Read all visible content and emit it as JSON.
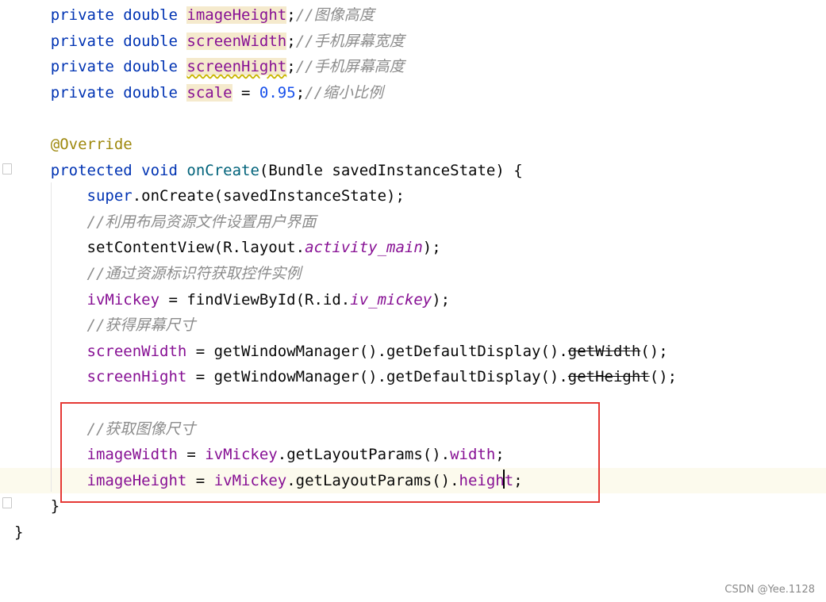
{
  "editor": {
    "lines": [
      {
        "tokens": [
          {
            "t": "    "
          },
          {
            "t": "private",
            "c": "kw"
          },
          {
            "t": " "
          },
          {
            "t": "double",
            "c": "kw"
          },
          {
            "t": " "
          },
          {
            "t": "imageHeight",
            "c": "field hl"
          },
          {
            "t": ";"
          },
          {
            "t": "//图像高度",
            "c": "comment"
          }
        ]
      },
      {
        "tokens": [
          {
            "t": "    "
          },
          {
            "t": "private",
            "c": "kw"
          },
          {
            "t": " "
          },
          {
            "t": "double",
            "c": "kw"
          },
          {
            "t": " "
          },
          {
            "t": "screenWidth",
            "c": "field hl"
          },
          {
            "t": ";"
          },
          {
            "t": "//手机屏幕宽度",
            "c": "comment"
          }
        ]
      },
      {
        "tokens": [
          {
            "t": "    "
          },
          {
            "t": "private",
            "c": "kw"
          },
          {
            "t": " "
          },
          {
            "t": "double",
            "c": "kw"
          },
          {
            "t": " "
          },
          {
            "t": "screenHight",
            "c": "field hl warn"
          },
          {
            "t": ";"
          },
          {
            "t": "//手机屏幕高度",
            "c": "comment"
          }
        ]
      },
      {
        "tokens": [
          {
            "t": "    "
          },
          {
            "t": "private",
            "c": "kw"
          },
          {
            "t": " "
          },
          {
            "t": "double",
            "c": "kw"
          },
          {
            "t": " "
          },
          {
            "t": "scale",
            "c": "field hl"
          },
          {
            "t": " = "
          },
          {
            "t": "0.95",
            "c": "num"
          },
          {
            "t": ";"
          },
          {
            "t": "//缩小比例",
            "c": "comment"
          }
        ]
      },
      {
        "tokens": []
      },
      {
        "tokens": [
          {
            "t": "    "
          },
          {
            "t": "@Override",
            "c": "annot"
          }
        ]
      },
      {
        "tokens": [
          {
            "t": "    "
          },
          {
            "t": "protected",
            "c": "kw"
          },
          {
            "t": " "
          },
          {
            "t": "void",
            "c": "kw"
          },
          {
            "t": " "
          },
          {
            "t": "onCreate",
            "c": "method"
          },
          {
            "t": "(Bundle savedInstanceState) {"
          }
        ]
      },
      {
        "tokens": [
          {
            "t": "        "
          },
          {
            "t": "super",
            "c": "kw"
          },
          {
            "t": ".onCreate(savedInstanceState);"
          }
        ]
      },
      {
        "tokens": [
          {
            "t": "        "
          },
          {
            "t": "//利用布局资源文件设置用户界面",
            "c": "comment"
          }
        ]
      },
      {
        "tokens": [
          {
            "t": "        "
          },
          {
            "t": "setContentView(R.layout."
          },
          {
            "t": "activity_main",
            "c": "field-i"
          },
          {
            "t": ");"
          }
        ]
      },
      {
        "tokens": [
          {
            "t": "        "
          },
          {
            "t": "//通过资源标识符获取控件实例",
            "c": "comment"
          }
        ]
      },
      {
        "tokens": [
          {
            "t": "        "
          },
          {
            "t": "ivMickey",
            "c": "field"
          },
          {
            "t": " = findViewById(R.id."
          },
          {
            "t": "iv_mickey",
            "c": "field-i"
          },
          {
            "t": ");"
          }
        ]
      },
      {
        "tokens": [
          {
            "t": "        "
          },
          {
            "t": "//获得屏幕尺寸",
            "c": "comment"
          }
        ]
      },
      {
        "tokens": [
          {
            "t": "        "
          },
          {
            "t": "screenWidth",
            "c": "field"
          },
          {
            "t": " = getWindowManager().getDefaultDisplay()."
          },
          {
            "t": "getWidth",
            "c": "strike"
          },
          {
            "t": "();"
          }
        ]
      },
      {
        "tokens": [
          {
            "t": "        "
          },
          {
            "t": "screenHight",
            "c": "field"
          },
          {
            "t": " = getWindowManager().getDefaultDisplay()."
          },
          {
            "t": "getHeight",
            "c": "strike"
          },
          {
            "t": "();"
          }
        ]
      },
      {
        "tokens": []
      },
      {
        "tokens": [
          {
            "t": "        "
          },
          {
            "t": "//获取图像尺寸",
            "c": "comment"
          }
        ]
      },
      {
        "tokens": [
          {
            "t": "        "
          },
          {
            "t": "imageWidth",
            "c": "field"
          },
          {
            "t": " = "
          },
          {
            "t": "ivMickey",
            "c": "field"
          },
          {
            "t": ".getLayoutParams()."
          },
          {
            "t": "width",
            "c": "field"
          },
          {
            "t": ";"
          }
        ]
      },
      {
        "tokens": [
          {
            "t": "        "
          },
          {
            "t": "imageHeight",
            "c": "field"
          },
          {
            "t": " = "
          },
          {
            "t": "ivMickey",
            "c": "field"
          },
          {
            "t": ".getLayoutParams()."
          },
          {
            "t": "height",
            "c": "field"
          },
          {
            "t": ";"
          }
        ]
      },
      {
        "tokens": [
          {
            "t": "    }"
          }
        ]
      },
      {
        "tokens": [
          {
            "t": "}"
          }
        ]
      }
    ]
  },
  "watermark": "CSDN @Yee.1128"
}
